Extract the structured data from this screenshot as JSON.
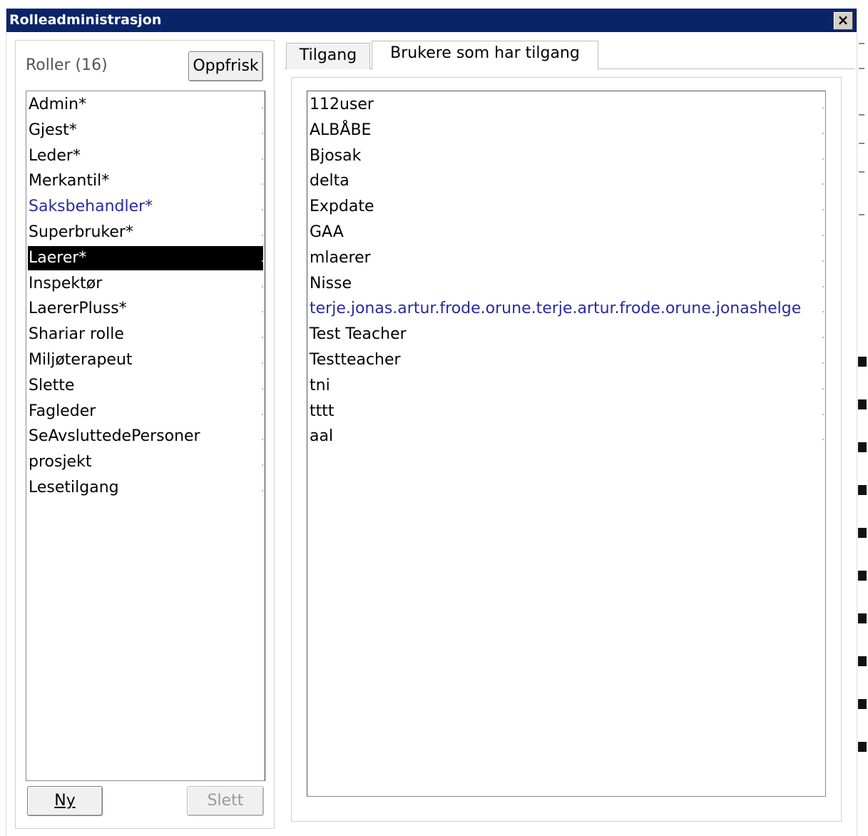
{
  "window": {
    "title": "Rolleadministrasjon",
    "close_glyph": "×"
  },
  "roles": {
    "header_label": "Roller (16)",
    "refresh_label": "Oppfrisk",
    "items": [
      "Admin*",
      "Gjest*",
      "Leder*",
      "Merkantil*",
      "Saksbehandler*",
      "Superbruker*",
      "Laerer*",
      "Inspektør",
      "LaererPluss*",
      "Shariar rolle",
      "Miljøterapeut",
      "Slette",
      "Fagleder",
      "SeAvsluttedePersoner",
      "prosjekt",
      "Lesetilgang"
    ],
    "selected_index": 6,
    "highlighted_index": 4,
    "new_label": "Ny",
    "delete_label": "Slett"
  },
  "tabs": [
    {
      "label": "Tilgang",
      "active": false
    },
    {
      "label": "Brukere som har tilgang",
      "active": true
    }
  ],
  "users": {
    "items": [
      "112user",
      "ALBÅBE",
      "Bjosak",
      "delta",
      "Expdate",
      "GAA",
      "mlaerer",
      "Nisse",
      "terje.jonas.artur.frode.orune.terje.artur.frode.orune.jonashelge",
      "Test Teacher",
      "Testteacher",
      "tni",
      "tttt",
      "aal"
    ],
    "highlighted_index": 8
  },
  "colors": {
    "titlebar": "#0a246a",
    "link_blue": "#2a2aa0",
    "selection": "#000000"
  }
}
